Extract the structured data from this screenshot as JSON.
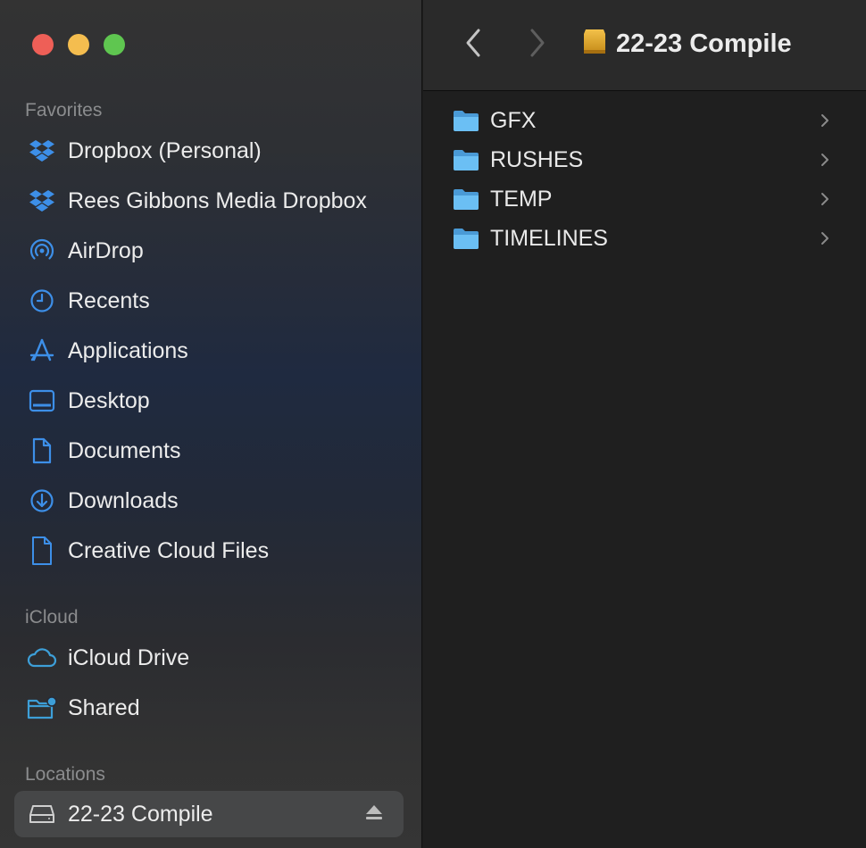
{
  "window": {
    "title": "22-23 Compile",
    "traffic_lights": {
      "close": "#ee5f57",
      "minimize": "#f4bd4f",
      "zoom": "#5fc650"
    }
  },
  "sidebar": {
    "sections": [
      {
        "title": "Favorites"
      },
      {
        "title": "iCloud"
      },
      {
        "title": "Locations"
      }
    ],
    "favorites": [
      {
        "label": "Dropbox (Personal)",
        "icon": "dropbox-icon"
      },
      {
        "label": "Rees Gibbons Media Dropbox",
        "icon": "dropbox-icon"
      },
      {
        "label": "AirDrop",
        "icon": "airdrop-icon"
      },
      {
        "label": "Recents",
        "icon": "clock-icon"
      },
      {
        "label": "Applications",
        "icon": "applications-icon"
      },
      {
        "label": "Desktop",
        "icon": "desktop-icon"
      },
      {
        "label": "Documents",
        "icon": "document-icon"
      },
      {
        "label": "Downloads",
        "icon": "download-icon"
      },
      {
        "label": "Creative Cloud Files",
        "icon": "file-icon"
      }
    ],
    "icloud": [
      {
        "label": "iCloud Drive",
        "icon": "cloud-icon"
      },
      {
        "label": "Shared",
        "icon": "shared-folder-icon"
      }
    ],
    "locations": [
      {
        "label": "22-23 Compile",
        "icon": "drive-icon",
        "selected": true
      }
    ]
  },
  "toolbar": {
    "back": "chevron-left-icon",
    "forward": "chevron-right-icon",
    "title": "22-23 Compile"
  },
  "main": {
    "items": [
      {
        "name": "GFX",
        "icon": "folder-icon"
      },
      {
        "name": "RUSHES",
        "icon": "folder-icon"
      },
      {
        "name": "TEMP",
        "icon": "folder-icon"
      },
      {
        "name": "TIMELINES",
        "icon": "folder-icon"
      }
    ]
  },
  "colors": {
    "accent": "#3b82f6",
    "folder": "#5ab1ef",
    "selection": "#464748"
  }
}
